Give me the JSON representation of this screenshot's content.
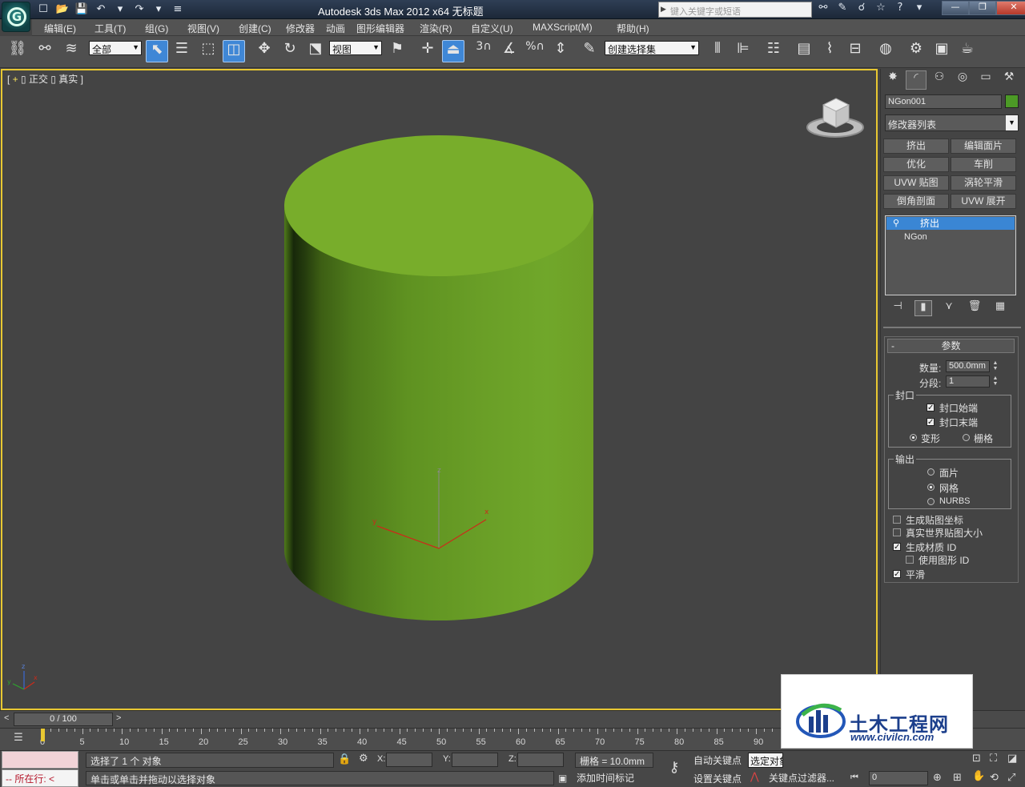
{
  "titlebar": {
    "logo_glyph": "G",
    "title": "Autodesk 3ds Max  2012 x64      无标题",
    "search_placeholder": "键入关键字或短语",
    "quick_access": [
      "☐",
      "📂",
      "💾",
      "↶",
      "▾",
      "↷",
      "▾",
      "≡"
    ],
    "tools": [
      "⚯",
      "✎",
      "☌",
      "☆",
      "?",
      "▾"
    ],
    "window": [
      "—",
      "❐",
      "✕"
    ]
  },
  "menus": [
    "编辑(E)",
    "工具(T)",
    "组(G)",
    "视图(V)",
    "创建(C)",
    "修改器",
    "动画",
    "图形编辑器",
    "渲染(R)",
    "自定义(U)",
    "MAXScript(M)",
    "帮助(H)"
  ],
  "toolbar": {
    "selection_filter": "全部",
    "ref_coord": "视图",
    "named_selection": "创建选择集",
    "snap_labels": [
      "3",
      "%"
    ]
  },
  "viewport": {
    "label_plus": "+",
    "label_view": "正交",
    "label_shading": "真实",
    "axis_x": "x",
    "axis_y": "y",
    "axis_z": "z"
  },
  "command_panel": {
    "object_name": "NGon001",
    "object_color": "#4c9a26",
    "modifier_list": "修改器列表",
    "buttons": [
      "挤出",
      "编辑面片",
      "优化",
      "车削",
      "UVW 贴图",
      "涡轮平滑",
      "倒角剖面",
      "UVW 展开"
    ],
    "stack": [
      "挤出",
      "NGon"
    ],
    "params": {
      "title": "参数",
      "amount_label": "数量:",
      "amount_value": "500.0mm",
      "segments_label": "分段:",
      "segments_value": "1",
      "capping_title": "封口",
      "cap_start": "封口始端",
      "cap_end": "封口末端",
      "morph": "变形",
      "grid": "栅格",
      "output_title": "输出",
      "patch": "面片",
      "mesh": "网格",
      "nurbs": "NURBS",
      "gen_mapping": "生成贴图坐标",
      "real_world": "真实世界贴图大小",
      "gen_matid": "生成材质 ID",
      "use_shape_ids": "使用图形 ID",
      "smooth": "平滑"
    }
  },
  "timeline": {
    "slider": "0 / 100",
    "ticks": [
      "0",
      "5",
      "10",
      "15",
      "20",
      "25",
      "30",
      "35",
      "40",
      "45",
      "50",
      "55",
      "60",
      "65",
      "70",
      "75",
      "80",
      "85",
      "90"
    ]
  },
  "status": {
    "script_prompt": "所在行:",
    "selected": "选择了 1 个 对象",
    "prompt": "单击或单击并拖动以选择对象",
    "x_label": "X:",
    "y_label": "Y:",
    "z_label": "Z:",
    "grid": "栅格 = 10.0mm",
    "time_tag": "添加时间标记",
    "auto_key": "自动关键点",
    "set_key": "设置关键点",
    "selected_drop": "选定对象",
    "key_filters": "关键点过滤器...",
    "frame": "0"
  },
  "watermark": {
    "name": "土木工程网",
    "url": "www.civilcn.com"
  }
}
